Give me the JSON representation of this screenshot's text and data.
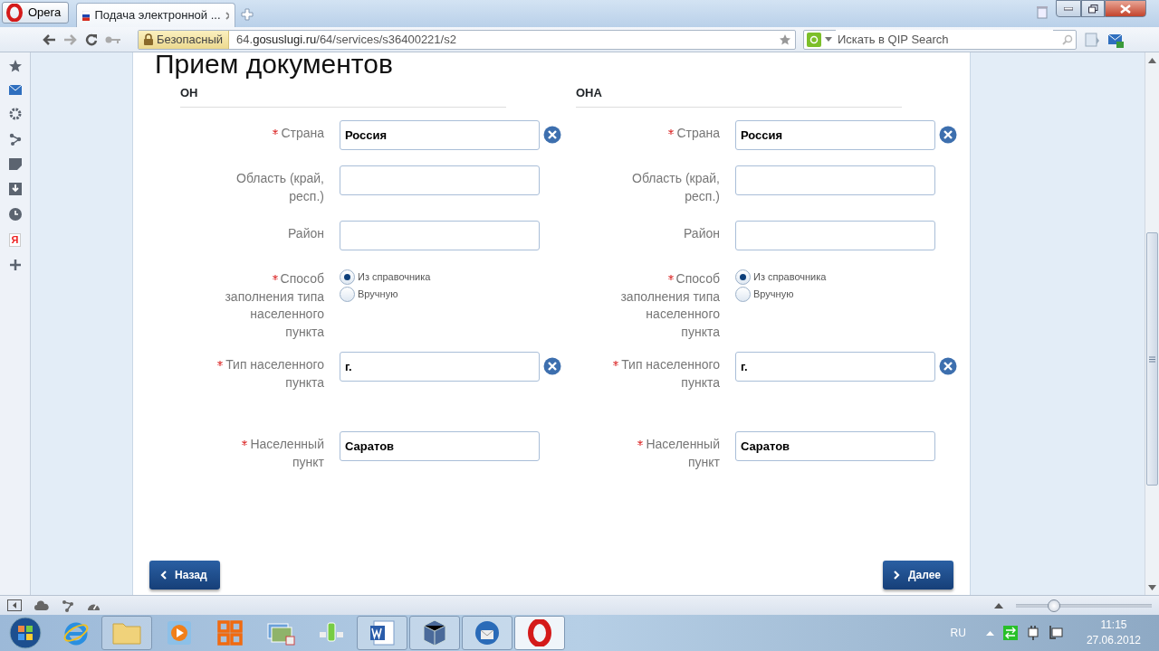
{
  "browser": {
    "menu_button": "Opera",
    "tabs": [
      {
        "title": "Подача электронной ...",
        "selected": true
      }
    ],
    "security_badge": "Безопасный",
    "address": "64.**gosuslugi.ru**/64/services/s36400221/s2",
    "search": {
      "placeholder": "Искать в QIP Search"
    },
    "sidebar_logo": "Я"
  },
  "page": {
    "title": "Прием документов",
    "sections": [
      {
        "heading": "ОН",
        "fields": [
          {
            "kind": "text",
            "label": "Страна",
            "required": true,
            "value": "Россия",
            "clearable": true
          },
          {
            "kind": "text",
            "label": "Область (край, респ.)",
            "required": false,
            "clearable": false
          },
          {
            "kind": "text",
            "label": "Район",
            "required": false,
            "clearable": false
          },
          {
            "kind": "radio",
            "label": "Способ заполнения типа населенного пункта",
            "required": true,
            "options": [
              {
                "label": "Из справочника",
                "selected": true
              },
              {
                "label": "Вручную",
                "selected": false
              }
            ]
          },
          {
            "kind": "text",
            "label": "Тип населенного пункта",
            "required": true,
            "value": "г.",
            "clearable": true
          },
          {
            "kind": "text",
            "label": "Населенный пункт",
            "required": true,
            "value": "Саратов",
            "clearable": false
          }
        ]
      },
      {
        "heading": "ОНА",
        "fields": [
          {
            "kind": "text",
            "label": "Страна",
            "required": true,
            "value": "Россия",
            "clearable": true
          },
          {
            "kind": "text",
            "label": "Область (край, респ.)",
            "required": false,
            "clearable": false
          },
          {
            "kind": "text",
            "label": "Район",
            "required": false,
            "clearable": false
          },
          {
            "kind": "radio",
            "label": "Способ заполнения типа населенного пункта",
            "required": true,
            "options": [
              {
                "label": "Из справочника",
                "selected": true
              },
              {
                "label": "Вручную",
                "selected": false
              }
            ]
          },
          {
            "kind": "text",
            "label": "Тип населенного пункта",
            "required": true,
            "value": "г.",
            "clearable": true
          },
          {
            "kind": "text",
            "label": "Населенный пункт",
            "required": true,
            "value": "Саратов",
            "clearable": false
          }
        ]
      }
    ],
    "back_button": "Назад",
    "next_button": "Далее"
  },
  "status_bar": {
    "zoom_slider": {
      "level": 0.28
    }
  },
  "taskbar": {
    "language": "RU",
    "time": "11:15",
    "date": "27.06.2012"
  }
}
